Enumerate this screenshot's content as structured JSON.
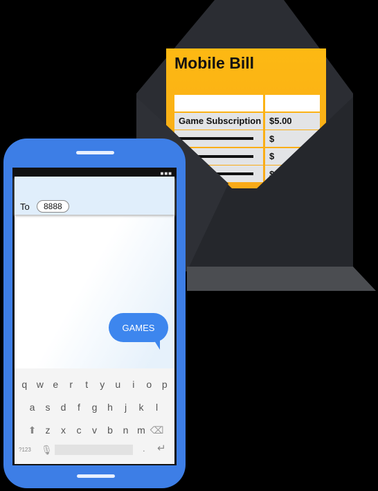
{
  "bill": {
    "title": "Mobile Bill",
    "rows": [
      {
        "label": "Game Subscription",
        "amount": "$5.00"
      },
      {
        "amount": "$"
      },
      {
        "amount": "$"
      },
      {
        "amount": "$"
      }
    ]
  },
  "phone": {
    "to_label": "To",
    "recipient": "8888",
    "message": "GAMES",
    "keyboard": {
      "row1": [
        "q",
        "w",
        "e",
        "r",
        "t",
        "y",
        "u",
        "i",
        "o",
        "p"
      ],
      "row2": [
        "a",
        "s",
        "d",
        "f",
        "g",
        "h",
        "j",
        "k",
        "l"
      ],
      "row3": [
        "z",
        "x",
        "c",
        "v",
        "b",
        "n",
        "m"
      ],
      "symbols": "?123",
      "period": "."
    }
  },
  "colors": {
    "phone": "#3d7ee6",
    "bubble": "#3d86ee",
    "bill": "#fdb913",
    "envelope": "#2b2d33"
  }
}
